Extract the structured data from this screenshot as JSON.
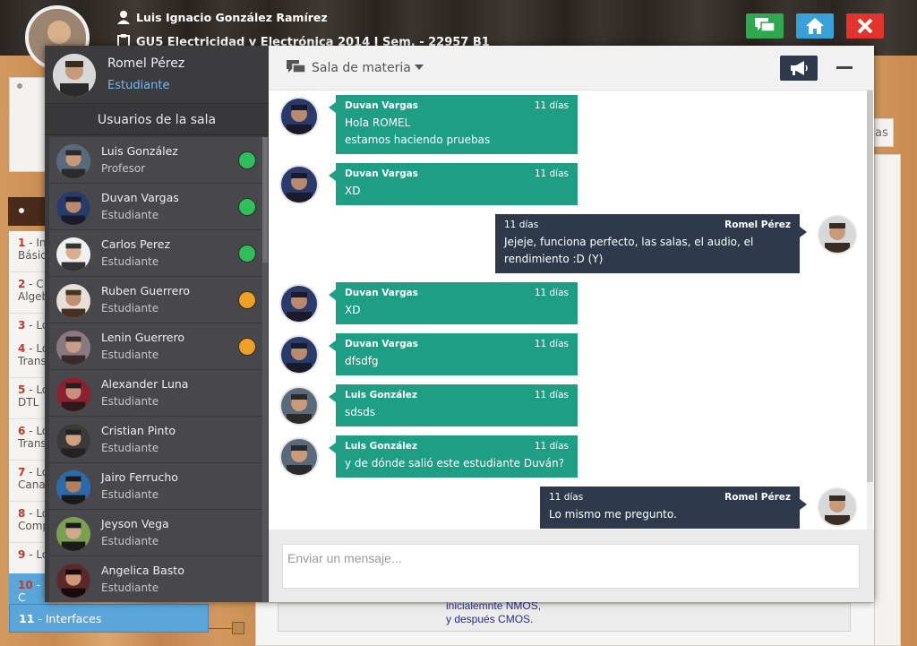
{
  "header": {
    "user_name": "Luis Ignacio González Ramírez",
    "course": "GU5 Electricidad y Electrónica 2014 I Sem. - 22957 B1"
  },
  "colors": {
    "chat_green": "#2fa84f",
    "home_blue": "#3aa0d8",
    "close_red": "#e2332c",
    "online": "#2ec05b",
    "away": "#f0a023"
  },
  "background_list": [
    {
      "num": "1",
      "text": "- In Básic"
    },
    {
      "num": "2",
      "text": "- Ci Algeb"
    },
    {
      "num": "3",
      "text": "- Ló"
    },
    {
      "num": "4",
      "text": "- Ló Trans"
    },
    {
      "num": "5",
      "text": "- Ló DTL"
    },
    {
      "num": "6",
      "text": "- Ló Trans"
    },
    {
      "num": "7",
      "text": "- Ló Cana"
    },
    {
      "num": "8",
      "text": "- Ló Comp"
    },
    {
      "num": "9",
      "text": "- Ló"
    },
    {
      "num": "10",
      "text": "- C"
    },
    {
      "num": "11",
      "text": "- Interfaces"
    }
  ],
  "background_text": {
    "nmos": "inicialemnte NMOS,",
    "cmos": "y después CMOS.",
    "las": "as"
  },
  "chat": {
    "me": {
      "name": "Romel Pérez",
      "role": "Estudiante"
    },
    "users_title": "Usuarios de la sala",
    "users": [
      {
        "name": "Luis González",
        "role": "Profesor",
        "status": "online"
      },
      {
        "name": "Duvan Vargas",
        "role": "Estudiante",
        "status": "online"
      },
      {
        "name": "Carlos Perez",
        "role": "Estudiante",
        "status": "online"
      },
      {
        "name": "Ruben Guerrero",
        "role": "Estudiante",
        "status": "away"
      },
      {
        "name": "Lenin Guerrero",
        "role": "Estudiante",
        "status": "away"
      },
      {
        "name": "Alexander Luna",
        "role": "Estudiante",
        "status": "none"
      },
      {
        "name": "Cristian Pinto",
        "role": "Estudiante",
        "status": "none"
      },
      {
        "name": "Jairo Ferrucho",
        "role": "Estudiante",
        "status": "none"
      },
      {
        "name": "Jeyson Vega",
        "role": "Estudiante",
        "status": "none"
      },
      {
        "name": "Angelica Basto",
        "role": "Estudiante",
        "status": "none"
      }
    ],
    "room_name": "Sala de materia",
    "messages": [
      {
        "author": "Duvan Vargas",
        "time": "11 días",
        "text": "Hola ROMEL\nestamos haciendo pruebas",
        "dir": "in"
      },
      {
        "author": "Duvan Vargas",
        "time": "11 días",
        "text": "XD",
        "dir": "in"
      },
      {
        "author": "Romel Pérez",
        "time": "11 días",
        "text": "Jejeje, funciona perfecto, las salas, el audio, el rendimiento :D (Y)",
        "dir": "out"
      },
      {
        "author": "Duvan Vargas",
        "time": "11 días",
        "text": "XD",
        "dir": "in"
      },
      {
        "author": "Duvan Vargas",
        "time": "11 días",
        "text": "dfsdfg",
        "dir": "in"
      },
      {
        "author": "Luis González",
        "time": "11 días",
        "text": "sdsds",
        "dir": "in"
      },
      {
        "author": "Luis González",
        "time": "11 días",
        "text": "y de dónde salió este estudiante Duván?",
        "dir": "in"
      },
      {
        "author": "Romel Pérez",
        "time": "11 días",
        "text": "Lo mismo me pregunto.",
        "dir": "out"
      }
    ],
    "input_placeholder": "Enviar un mensaje..."
  }
}
